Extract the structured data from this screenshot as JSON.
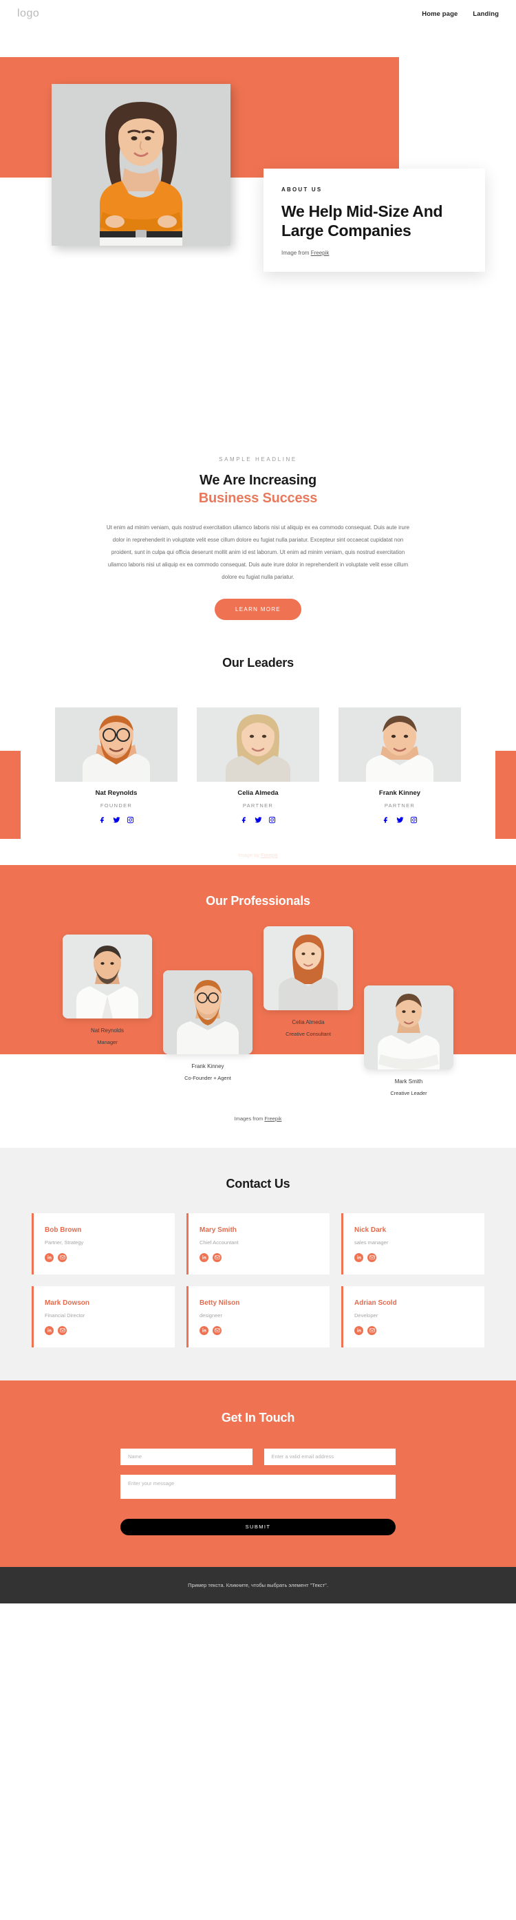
{
  "header": {
    "logo": "logo",
    "nav": [
      {
        "label": "Home page"
      },
      {
        "label": "Landing"
      }
    ]
  },
  "hero": {
    "eyebrow": "ABOUT US",
    "title": "We Help Mid-Size And Large Companies",
    "credit_prefix": "Image from ",
    "credit_link": "Freepik"
  },
  "sample": {
    "eyebrow": "SAMPLE HEADLINE",
    "line1": "We Are Increasing",
    "line2": "Business Success",
    "paragraph": "Ut enim ad minim veniam, quis nostrud exercitation ullamco laboris nisi ut aliquip ex ea commodo consequat. Duis aute irure dolor in reprehenderit in voluptate velit esse cillum dolore eu fugiat nulla pariatur. Excepteur sint occaecat cupidatat non proident, sunt in culpa qui officia deserunt mollit anim id est laborum. Ut enim ad minim veniam, quis nostrud exercitation ullamco laboris nisi ut aliquip ex ea commodo consequat. Duis aute irure dolor in reprehenderit in voluptate velit esse cillum dolore eu fugiat nulla pariatur.",
    "button": "LEARN MORE"
  },
  "leaders": {
    "title": "Our Leaders",
    "credit_prefix": "Image by ",
    "credit_link": "Freepik",
    "people": [
      {
        "name": "Nat Reynolds",
        "role": "FOUNDER"
      },
      {
        "name": "Celia Almeda",
        "role": "PARTNER"
      },
      {
        "name": "Frank Kinney",
        "role": "PARTNER"
      }
    ]
  },
  "professionals": {
    "title": "Our Professionals",
    "credit_prefix": "Images from ",
    "credit_link": "Freepik",
    "people": [
      {
        "name": "Nat Reynolds",
        "role": "Manager"
      },
      {
        "name": "Frank Kinney",
        "role": "Co-Founder + Agent"
      },
      {
        "name": "Celia Almeda",
        "role": "Creative Consultant"
      },
      {
        "name": "Mark Smith",
        "role": "Creative Leader"
      }
    ]
  },
  "contact": {
    "title": "Contact Us",
    "cards": [
      {
        "name": "Bob Brown",
        "role": "Partner, Strategy"
      },
      {
        "name": "Mary Smith",
        "role": "Chief Accountant"
      },
      {
        "name": "Nick Dark",
        "role": "sales manager"
      },
      {
        "name": "Mark Dowson",
        "role": "Financial Director"
      },
      {
        "name": "Betty Nilson",
        "role": "designeer"
      },
      {
        "name": "Adrian Scold",
        "role": "Developer"
      }
    ]
  },
  "form": {
    "title": "Get In Touch",
    "name_placeholder": "Name",
    "email_placeholder": "Enter a valid email address",
    "message_placeholder": "Enter your message",
    "submit": "SUBMIT"
  },
  "footer": {
    "text": "Пример текста. Кликните, чтобы выбрать элемент \"Текст\"."
  },
  "colors": {
    "accent": "#ef7352",
    "accent_text": "#e8795c",
    "dark": "#1b1b1b",
    "footer_bg": "#333333",
    "contact_bg": "#f1f1f1"
  }
}
